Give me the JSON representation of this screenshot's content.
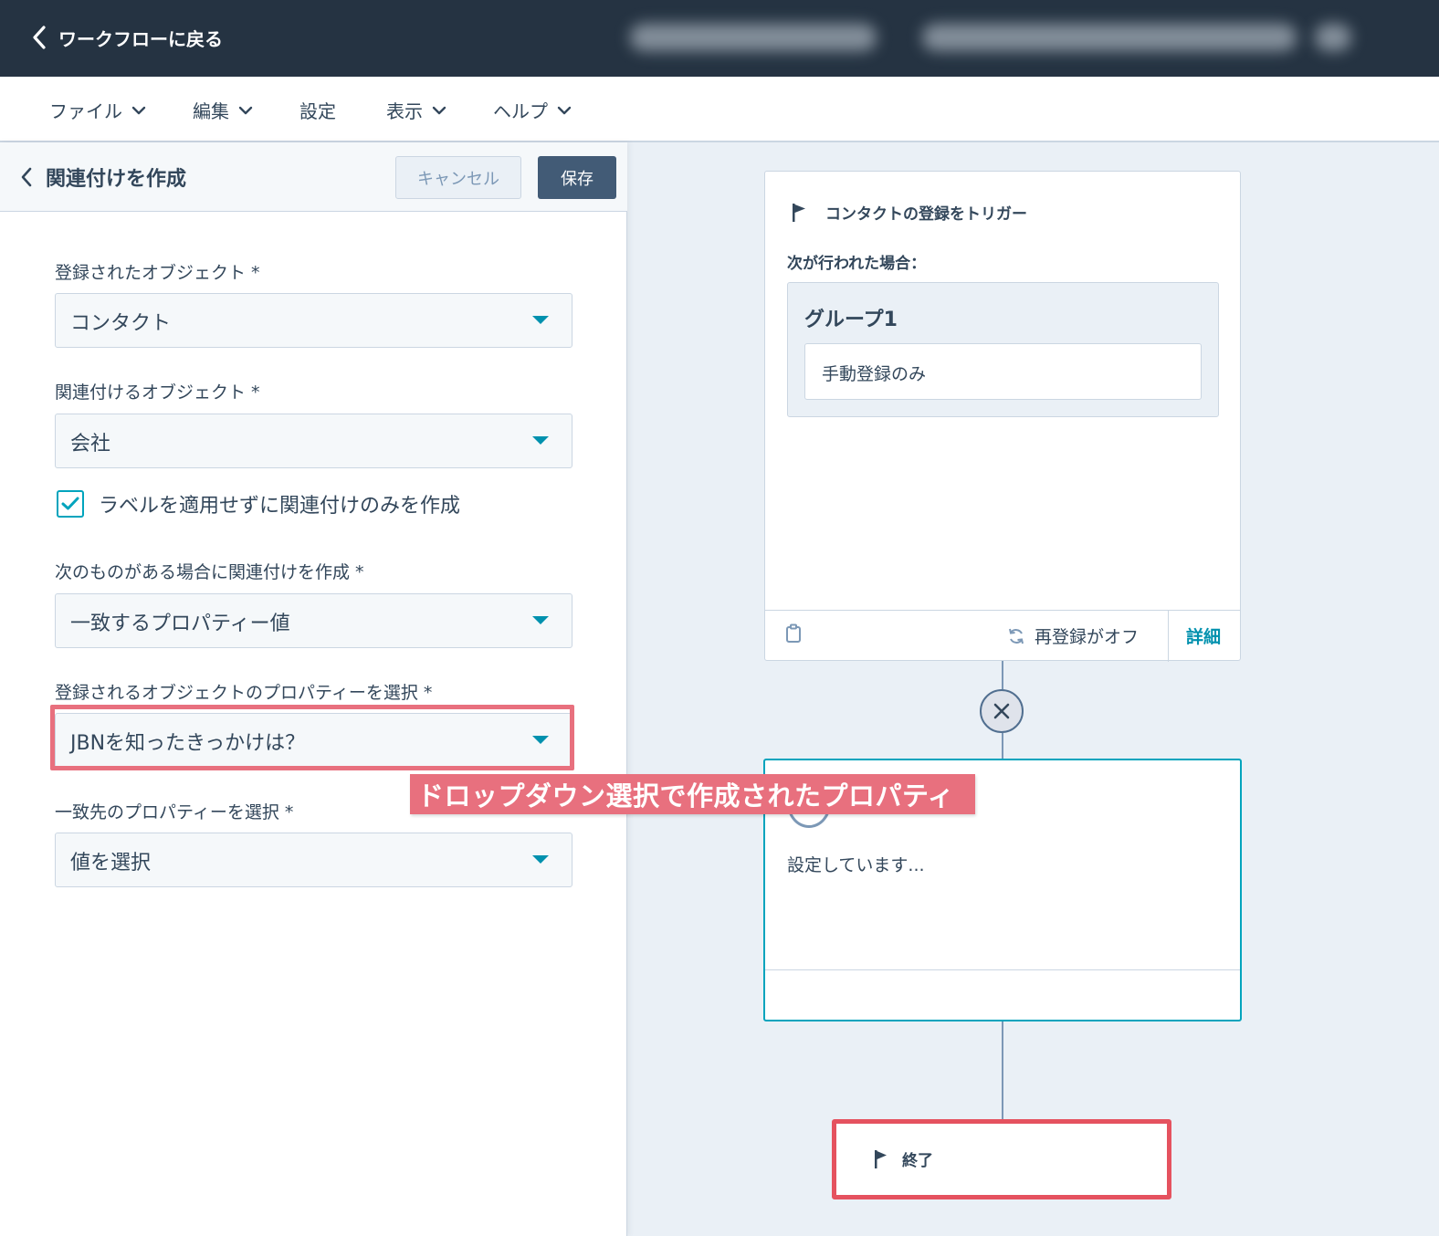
{
  "topbar": {
    "back_label": "ワークフローに戻る"
  },
  "menu": {
    "items": [
      {
        "label": "ファイル",
        "has_caret": true
      },
      {
        "label": "編集",
        "has_caret": true
      },
      {
        "label": "設定",
        "has_caret": false
      },
      {
        "label": "表示",
        "has_caret": true
      },
      {
        "label": "ヘルプ",
        "has_caret": true
      }
    ]
  },
  "panel": {
    "title": "関連付けを作成",
    "cancel_label": "キャンセル",
    "save_label": "保存",
    "fields": [
      {
        "label": "登録されたオブジェクト *",
        "value": "コンタクト"
      },
      {
        "label": "関連付けるオブジェクト *",
        "value": "会社"
      },
      {
        "label": "次のものがある場合に関連付けを作成 *",
        "value": "一致するプロパティー値"
      },
      {
        "label": "登録されるオブジェクトのプロパティーを選択 *",
        "value": "JBNを知ったきっかけは？"
      },
      {
        "label": "一致先のプロパティーを選択 *",
        "value": "値を選択"
      }
    ],
    "checkbox": {
      "label": "ラベルを適用せずに関連付けのみを作成",
      "checked": true
    }
  },
  "annotation": {
    "text": "ドロップダウン選択で作成されたプロパティ",
    "color": "#e8707e"
  },
  "trigger_card": {
    "title": "コンタクトの登録をトリガー",
    "subtitle": "次が行われた場合：",
    "group_title": "グループ1",
    "group_item": "手動登録のみ",
    "reenroll_label": "再登録がオフ",
    "details_label": "詳細"
  },
  "action_card": {
    "status_text": "設定しています..."
  },
  "end_card": {
    "label": "終了"
  },
  "colors": {
    "topbar": "#253342",
    "accent": "#0091ae",
    "save_button": "#425b76",
    "highlight_red": "#e5525f"
  }
}
